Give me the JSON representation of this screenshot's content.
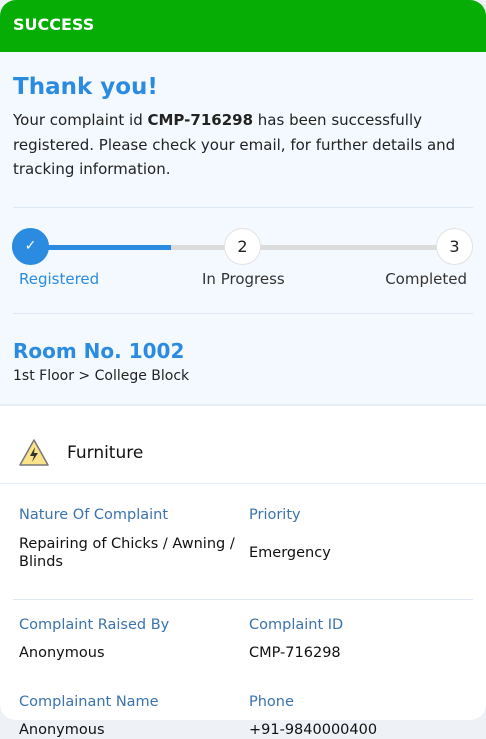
{
  "header": {
    "status": "SUCCESS"
  },
  "thanks": {
    "title": "Thank you!",
    "msg_prefix": "Your complaint id ",
    "complaint_id": "CMP-716298",
    "msg_suffix": " has been successfully registered. Please check your email, for further details and tracking information."
  },
  "stepper": {
    "progress_fraction": 0.33,
    "steps": [
      {
        "label": "Registered",
        "marker": "✓",
        "state": "done"
      },
      {
        "label": "In Progress",
        "marker": "2",
        "state": "pending"
      },
      {
        "label": "Completed",
        "marker": "3",
        "state": "pending"
      }
    ]
  },
  "location": {
    "room": "Room No. 1002",
    "path": "1st Floor > College Block"
  },
  "category": {
    "icon": "warning-lightning-icon",
    "name": "Furniture"
  },
  "details": [
    {
      "label": "Nature Of Complaint",
      "value": "Repairing of Chicks / Awning / Blinds"
    },
    {
      "label": "Priority",
      "value": "Emergency"
    },
    {
      "label": "Complaint Raised By",
      "value": "Anonymous"
    },
    {
      "label": "Complaint ID",
      "value": "CMP-716298"
    },
    {
      "label": "Complainant Name",
      "value": "Anonymous"
    },
    {
      "label": "Phone",
      "value": "+91-9840000400"
    }
  ],
  "colors": {
    "success": "#05ad05",
    "accent": "#2a8be0",
    "label": "#3a73ad"
  }
}
